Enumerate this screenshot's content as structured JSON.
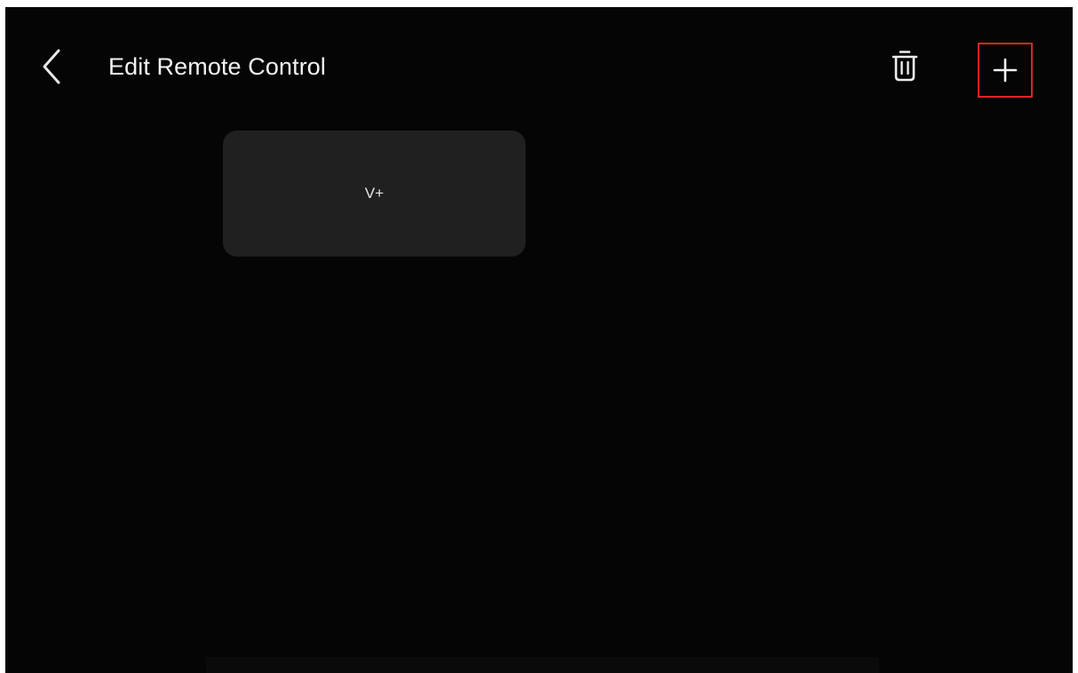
{
  "header": {
    "title": "Edit Remote Control",
    "back_icon": "chevron-left-icon",
    "delete_icon": "trash-icon",
    "add_icon": "plus-icon"
  },
  "keys": [
    {
      "label": "V+"
    }
  ],
  "colors": {
    "background": "#050505",
    "key_background": "#202020",
    "text": "#f2f2f2",
    "highlight_border": "#d8281f"
  }
}
